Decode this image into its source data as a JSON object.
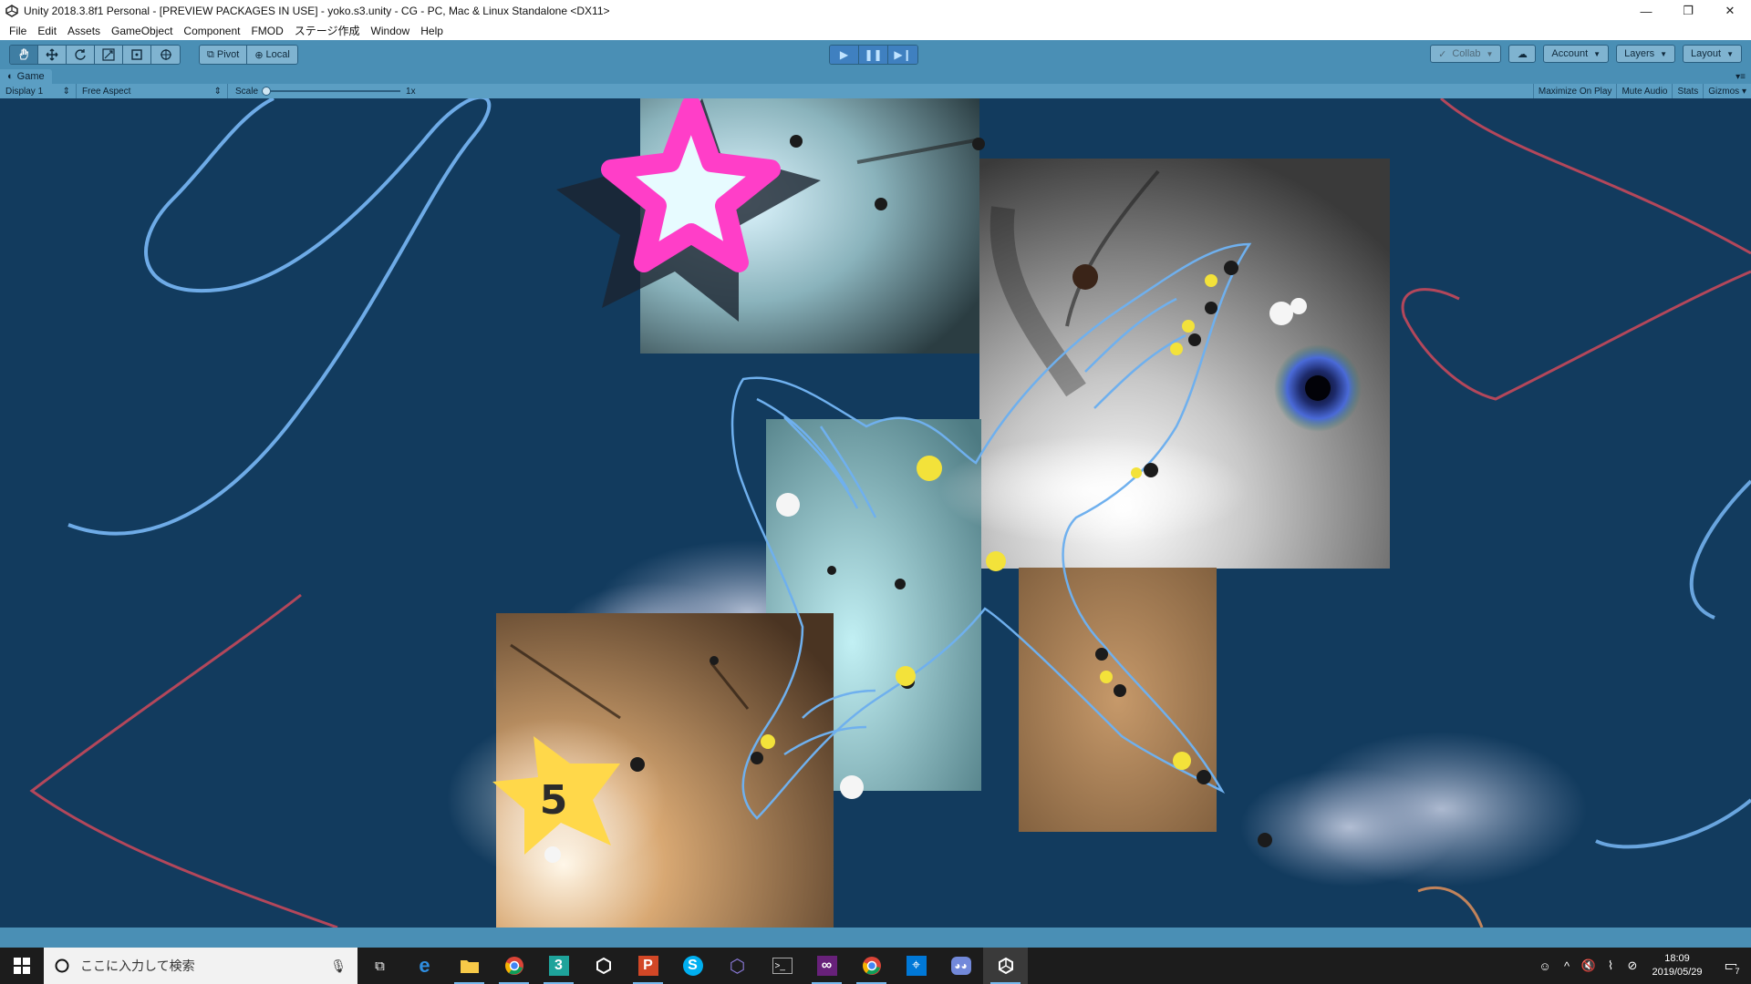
{
  "window": {
    "title": "Unity 2018.3.8f1 Personal - [PREVIEW PACKAGES IN USE] - yoko.s3.unity - CG - PC, Mac & Linux Standalone <DX11>",
    "minimize": "—",
    "restore": "❐",
    "close": "✕"
  },
  "menubar": {
    "items": [
      "File",
      "Edit",
      "Assets",
      "GameObject",
      "Component",
      "FMOD",
      "ステージ作成",
      "Window",
      "Help"
    ]
  },
  "toolbar": {
    "pivot_label": "Pivot",
    "local_label": "Local",
    "collab_label": "Collab",
    "account_label": "Account",
    "layers_label": "Layers",
    "layout_label": "Layout"
  },
  "game_view": {
    "tab_label": "Game",
    "display_label": "Display 1",
    "aspect_label": "Free Aspect",
    "scale_label": "Scale",
    "scale_value": "1x",
    "maximize_label": "Maximize On Play",
    "mute_label": "Mute Audio",
    "stats_label": "Stats",
    "gizmos_label": "Gizmos",
    "star_number": "5"
  },
  "taskbar": {
    "search_placeholder": "ここに入力して検索",
    "time": "18:09",
    "date": "2019/05/29",
    "notification_count": "7"
  },
  "colors": {
    "editor_blue": "#4a8fb5",
    "game_background": "#123b5e",
    "play_active": "#3f80c0",
    "star_pink": "#ff3ec8",
    "star_yellow": "#ffd84a"
  }
}
